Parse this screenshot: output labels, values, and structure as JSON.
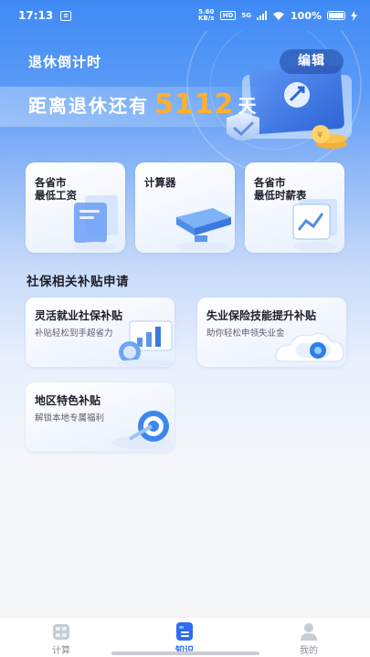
{
  "status_bar": {
    "time": "17:13",
    "notification_glyph": "≡",
    "net_speed": "5.60 KB/s",
    "hd_label": "HD",
    "network_label": "5G",
    "battery": "100%"
  },
  "hero": {
    "title": "退休倒计时",
    "edit_label": "编辑",
    "countdown_prefix": "距离退休还有",
    "countdown_days": "5112",
    "countdown_suffix": "天"
  },
  "quick_cards": [
    {
      "title_line1": "各省市",
      "title_line2": "最低工资",
      "icon": "document-card-icon"
    },
    {
      "title_line1": "计算器",
      "title_line2": "",
      "icon": "calculator-icon"
    },
    {
      "title_line1": "各省市",
      "title_line2": "最低时薪表",
      "icon": "table-chart-icon"
    }
  ],
  "subsidy_section": {
    "title": "社保相关补贴申请",
    "cards": [
      {
        "title": "灵活就业社保补贴",
        "subtitle": "补贴轻松到手超省力",
        "icon": "bar-chart-coin-icon"
      },
      {
        "title": "失业保险技能提升补贴",
        "subtitle": "助你轻松申领失业金",
        "icon": "cloud-toggle-icon"
      },
      {
        "title": "地区特色补贴",
        "subtitle": "解锁本地专属福利",
        "icon": "target-icon"
      }
    ]
  },
  "tabbar": {
    "items": [
      {
        "label": "计算",
        "icon": "calculator-tab-icon",
        "active": false
      },
      {
        "label": "知识",
        "icon": "document-tab-icon",
        "active": true
      },
      {
        "label": "我的",
        "icon": "user-tab-icon",
        "active": false
      }
    ]
  },
  "colors": {
    "accent": "#2d6cf0",
    "countdown_number": "#ffb02e",
    "hero_top": "#3f8af5"
  }
}
